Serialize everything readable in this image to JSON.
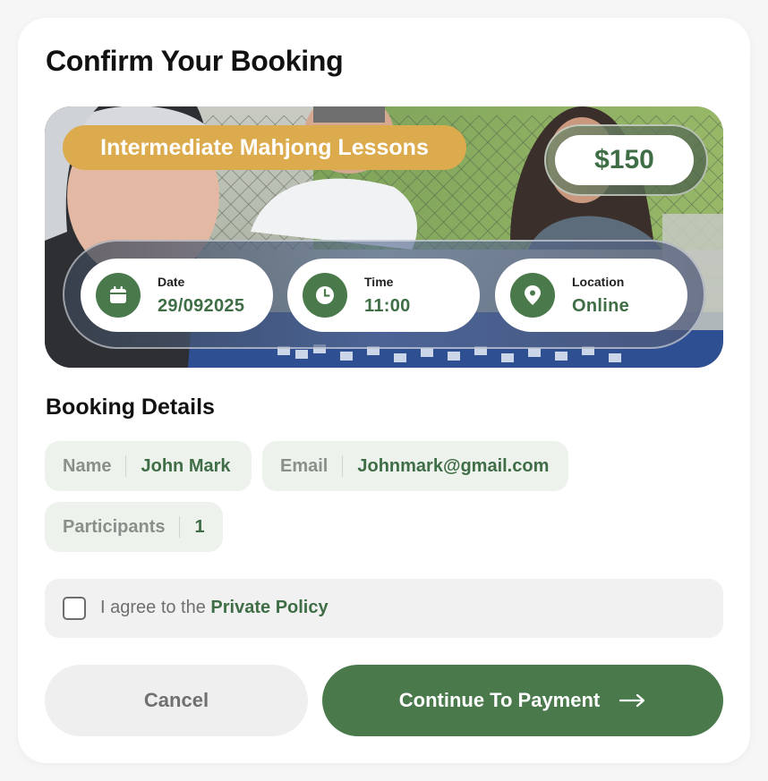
{
  "page": {
    "title": "Confirm Your Booking"
  },
  "hero": {
    "course_title": "Intermediate Mahjong Lessons",
    "price": "$150",
    "info": [
      {
        "icon": "calendar-icon",
        "label": "Date",
        "value": "29/092025"
      },
      {
        "icon": "clock-icon",
        "label": "Time",
        "value": "11:00"
      },
      {
        "icon": "location-pin-icon",
        "label": "Location",
        "value": "Online"
      }
    ]
  },
  "details": {
    "section_title": "Booking Details",
    "fields": [
      {
        "label": "Name",
        "value": "John Mark"
      },
      {
        "label": "Email",
        "value": "Johnmark@gmail.com"
      },
      {
        "label": "Participants",
        "value": "1"
      }
    ]
  },
  "agreement": {
    "checked": false,
    "text_prefix": "I agree to the ",
    "link_text": "Private Policy"
  },
  "buttons": {
    "cancel": "Cancel",
    "continue": "Continue To Payment"
  },
  "colors": {
    "accent_green": "#4a7a4c",
    "text_green": "#3f6e46",
    "course_pill": "#dcab4e",
    "chip_bg": "#edf2ed"
  }
}
